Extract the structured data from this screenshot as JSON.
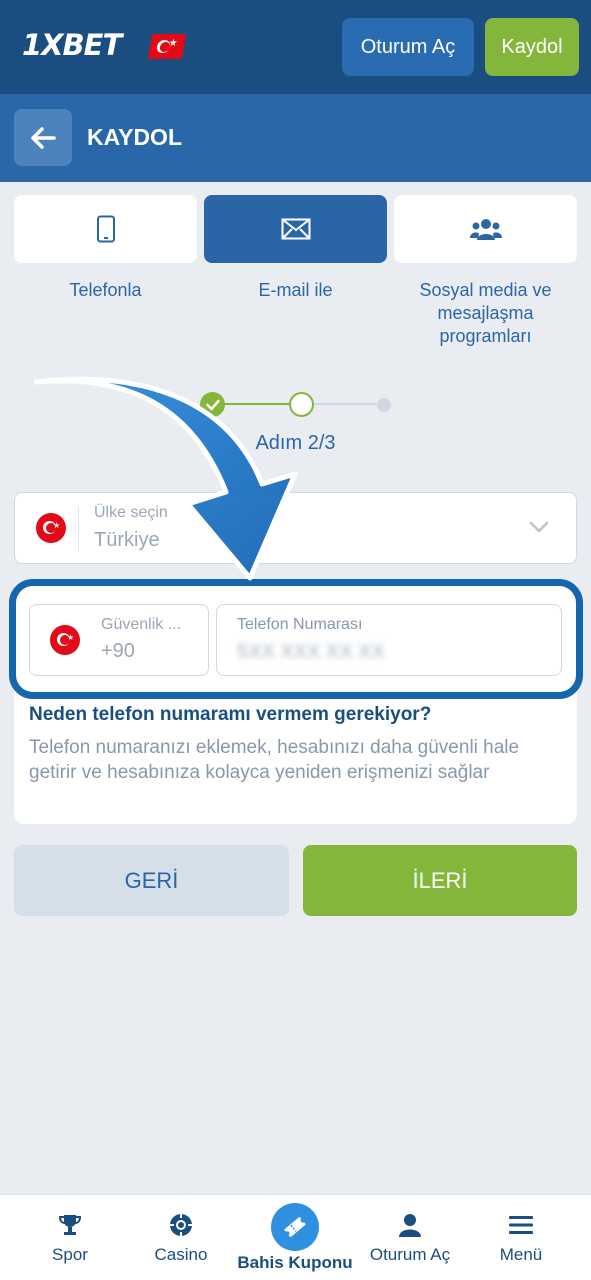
{
  "header": {
    "logo_text": "1XBET",
    "login_label": "Oturum Aç",
    "register_label": "Kaydol"
  },
  "titlebar": {
    "title": "KAYDOL"
  },
  "tabs": [
    {
      "label": "Telefonla",
      "icon": "phone-icon"
    },
    {
      "label": "E-mail ile",
      "icon": "envelope-icon",
      "active": true
    },
    {
      "label": "Sosyal media ve mesajlaşma programları",
      "icon": "users-icon"
    }
  ],
  "stepper": {
    "label": "Adım 2/3",
    "current": 2,
    "total": 3
  },
  "country": {
    "label": "Ülke seçin",
    "value": "Türkiye"
  },
  "phone": {
    "code_label": "Güvenlik ...",
    "code_value": "+90",
    "number_label": "Telefon Numarası",
    "number_value": "5XX XXX XX XX",
    "why_title": "Neden telefon numaramı vermem gerekiyor?",
    "why_text": "Telefon numaranızı eklemek, hesabınızı daha güvenli hale getirir ve hesabınıza kolayca yeniden erişmenizi sağlar"
  },
  "actions": {
    "back_label": "GERİ",
    "next_label": "İLERİ"
  },
  "bottom_nav": [
    {
      "label": "Spor",
      "icon": "trophy-icon"
    },
    {
      "label": "Casino",
      "icon": "chip-icon"
    },
    {
      "label": "Bahis Kuponu",
      "icon": "ticket-icon"
    },
    {
      "label": "Oturum Aç",
      "icon": "user-icon"
    },
    {
      "label": "Menü",
      "icon": "menu-icon"
    }
  ],
  "colors": {
    "header_bg": "#1a4e80",
    "title_bg": "#2967a8",
    "accent_green": "#83b63a",
    "accent_blue": "#2a66a6",
    "page_bg": "#e9edf1",
    "highlight_ring": "#1566ad"
  }
}
